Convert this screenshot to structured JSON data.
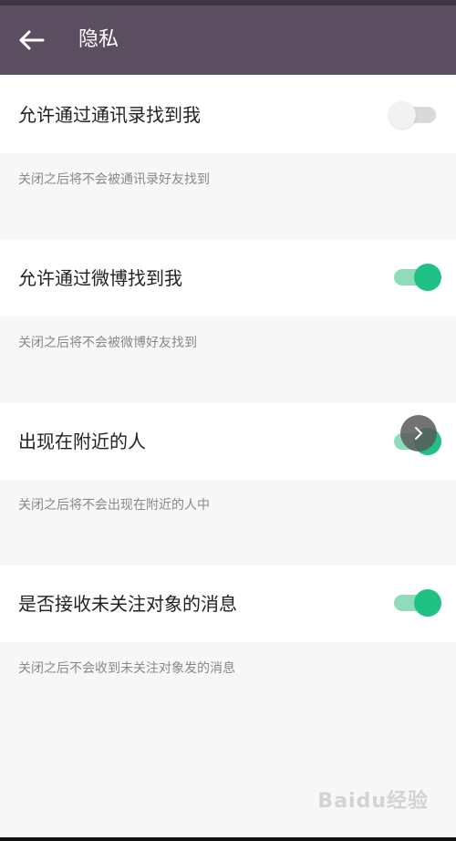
{
  "app_bar": {
    "title": "隐私",
    "back_icon": "arrow-left-icon"
  },
  "settings": [
    {
      "label": "允许通过通讯录找到我",
      "description": "关闭之后将不会被通讯录好友找到",
      "enabled": false
    },
    {
      "label": "允许通过微博找到我",
      "description": "关闭之后将不会被微博好友找到",
      "enabled": true
    },
    {
      "label": "出现在附近的人",
      "description": "关闭之后将不会出现在附近的人中",
      "enabled": true
    },
    {
      "label": "是否接收未关注对象的消息",
      "description": "关闭之后不会收到未关注对象发的消息",
      "enabled": true
    }
  ],
  "floating_ball": {
    "icon": "chevron-right-icon"
  },
  "watermark": {
    "text": "Baidu经验"
  },
  "colors": {
    "app_bar": "#5a4e60",
    "toggle_on": "#1fc184",
    "toggle_on_track": "#8fdcbb",
    "toggle_off": "#d9d9d9"
  }
}
